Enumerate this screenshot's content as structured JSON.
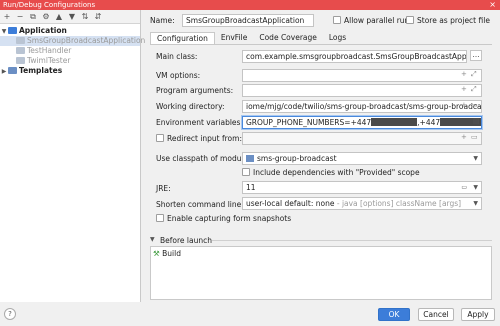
{
  "window": {
    "title": "Run/Debug Configurations",
    "close": "×"
  },
  "toolbar": {
    "icons": [
      "+",
      "−",
      "⧉",
      "⚙",
      "▲",
      "▼",
      "⇅",
      "⇵"
    ]
  },
  "tree": {
    "application": "Application",
    "children": [
      "SmsGroupBroadcastApplication",
      "TestHandler",
      "TwimlTester"
    ],
    "templates": "Templates"
  },
  "name_row": {
    "label": "Name:",
    "value": "SmsGroupBroadcastApplication",
    "allow_parallel": "Allow parallel run",
    "store_project": "Store as project file"
  },
  "tabs": [
    "Configuration",
    "EnvFile",
    "Code Coverage",
    "Logs"
  ],
  "form": {
    "main_class_label": "Main class:",
    "main_class_value": "com.example.smsgroupbroadcast.SmsGroupBroadcastApplication",
    "vm_options_label": "VM options:",
    "program_args_label": "Program arguments:",
    "working_dir_label": "Working directory:",
    "working_dir_value": "iome/mjg/code/twilio/sms-group-broadcast/sms-group-broadcast",
    "env_vars_label": "Environment variables:",
    "env_vars_prefix": "GROUP_PHONE_NUMBERS=+447",
    "env_vars_mid": ",+447",
    "redirect_label": "Redirect input from:",
    "classpath_label": "Use classpath of module:",
    "classpath_value": "sms-group-broadcast",
    "include_deps": "Include dependencies with \"Provided\" scope",
    "jre_label": "JRE:",
    "jre_value": "11",
    "shorten_label": "Shorten command line:",
    "shorten_value": "user-local default: none",
    "shorten_hint": " - java [options] className [args]",
    "snapshots_label": "Enable capturing form snapshots"
  },
  "before_launch": {
    "title": "Before launch",
    "item": "Build"
  },
  "buttons": {
    "help": "?",
    "ok": "OK",
    "cancel": "Cancel",
    "apply": "Apply"
  }
}
